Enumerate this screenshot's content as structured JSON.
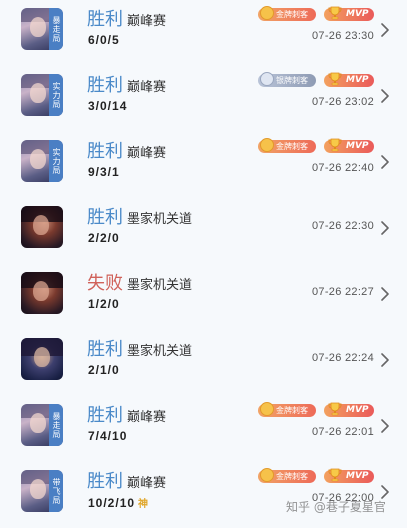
{
  "matches": [
    {
      "hero": "hero-a",
      "tag": "暴走局",
      "result": "胜利",
      "result_type": "win",
      "mode": "巅峰赛",
      "kda": "6/0/5",
      "badge": "gold",
      "badge_label": "金牌刺客",
      "mvp": "MVP",
      "time": "07-26 23:30",
      "shen": ""
    },
    {
      "hero": "hero-a",
      "tag": "实力局",
      "result": "胜利",
      "result_type": "win",
      "mode": "巅峰赛",
      "kda": "3/0/14",
      "badge": "silver",
      "badge_label": "银牌刺客",
      "mvp": "MVP",
      "time": "07-26 23:02",
      "shen": ""
    },
    {
      "hero": "hero-a",
      "tag": "实力局",
      "result": "胜利",
      "result_type": "win",
      "mode": "巅峰赛",
      "kda": "9/3/1",
      "badge": "gold",
      "badge_label": "金牌刺客",
      "mvp": "MVP",
      "time": "07-26 22:40",
      "shen": ""
    },
    {
      "hero": "hero-b",
      "tag": "",
      "result": "胜利",
      "result_type": "win",
      "mode": "墨家机关道",
      "kda": "2/2/0",
      "badge": "",
      "badge_label": "",
      "mvp": "",
      "time": "07-26 22:30",
      "shen": ""
    },
    {
      "hero": "hero-b",
      "tag": "",
      "result": "失败",
      "result_type": "lose",
      "mode": "墨家机关道",
      "kda": "1/2/0",
      "badge": "",
      "badge_label": "",
      "mvp": "",
      "time": "07-26 22:27",
      "shen": ""
    },
    {
      "hero": "hero-c",
      "tag": "",
      "result": "胜利",
      "result_type": "win",
      "mode": "墨家机关道",
      "kda": "2/1/0",
      "badge": "",
      "badge_label": "",
      "mvp": "",
      "time": "07-26 22:24",
      "shen": ""
    },
    {
      "hero": "hero-a",
      "tag": "暴走局",
      "result": "胜利",
      "result_type": "win",
      "mode": "巅峰赛",
      "kda": "7/4/10",
      "badge": "gold",
      "badge_label": "金牌刺客",
      "mvp": "MVP",
      "time": "07-26 22:01",
      "shen": ""
    },
    {
      "hero": "hero-a",
      "tag": "带飞局",
      "result": "胜利",
      "result_type": "win",
      "mode": "巅峰赛",
      "kda": "10/2/10",
      "badge": "gold",
      "badge_label": "金牌刺客",
      "mvp": "MVP",
      "time": "07-26 22:00",
      "shen": "神"
    }
  ],
  "watermark": "知乎 @巷子夏星官",
  "colors": {
    "win": "#4b8ac9",
    "lose": "#d0625a",
    "tag_bg": "#4a7fc4",
    "background": "#f6f9fc"
  },
  "icons": {
    "chevron": "chevron-right-icon",
    "mvp": "trophy-icon",
    "medal": "medal-icon"
  }
}
